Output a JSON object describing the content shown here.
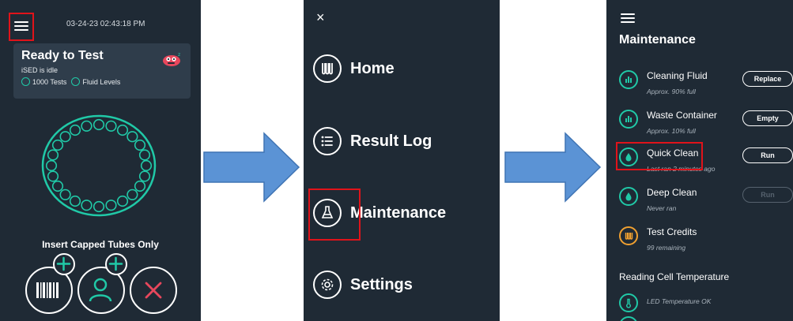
{
  "screen1": {
    "datetime": "03-24-23 02:43:18 PM",
    "status_title": "Ready to Test",
    "status_sub": "iSED is idle",
    "tests_label": "1000 Tests",
    "fluid_label": "Fluid Levels",
    "instruction": "Insert Capped Tubes Only",
    "icons": [
      "menu-icon",
      "barcode-icon",
      "add-patient-icon",
      "cancel-icon"
    ],
    "tube_slots": 24
  },
  "screen2": {
    "close_glyph": "×",
    "menu": [
      {
        "label": "Home",
        "icon": "tubes-icon"
      },
      {
        "label": "Result Log",
        "icon": "list-icon"
      },
      {
        "label": "Maintenance",
        "icon": "flask-brush-icon"
      },
      {
        "label": "Settings",
        "icon": "gear-icon"
      }
    ]
  },
  "screen3": {
    "title": "Maintenance",
    "items": [
      {
        "name": "Cleaning Fluid",
        "sub": "Approx. 90% full",
        "button": "Replace",
        "enabled": true
      },
      {
        "name": "Waste Container",
        "sub": "Approx. 10% full",
        "button": "Empty",
        "enabled": true
      },
      {
        "name": "Quick Clean",
        "sub": "Last ran 2 minutes ago",
        "button": "Run",
        "enabled": true
      },
      {
        "name": "Deep Clean",
        "sub": "Never ran",
        "button": "Run",
        "enabled": false
      },
      {
        "name": "Test Credits",
        "sub": "99 remaining",
        "button": "",
        "enabled": false
      }
    ],
    "section": "Reading Cell Temperature",
    "temp_status": "LED Temperature OK"
  },
  "colors": {
    "background": "#1f2a35",
    "card": "#2f3d4b",
    "accent": "#20c9a7",
    "credit": "#f0a030",
    "cancel": "#e8475c",
    "highlight": "#e0131a",
    "arrow_fill": "#5b93d5",
    "arrow_stroke": "#3f74b4"
  }
}
